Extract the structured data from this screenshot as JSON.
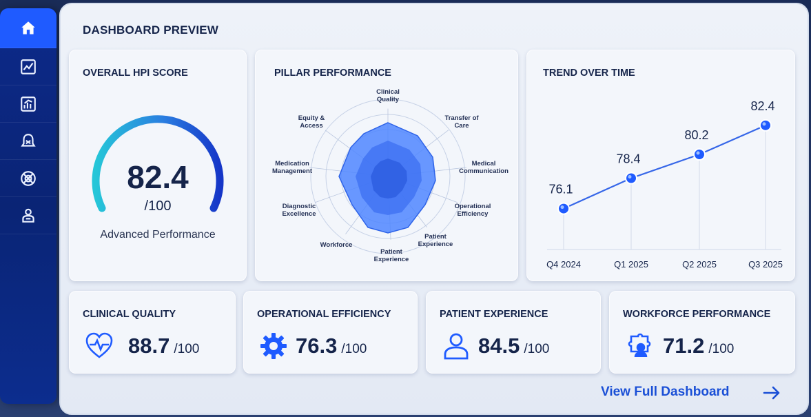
{
  "sidebar": {
    "items": [
      {
        "icon": "home-icon",
        "active": true
      },
      {
        "icon": "line-chart-icon"
      },
      {
        "icon": "bar-chart-icon"
      },
      {
        "icon": "alert-bell-icon"
      },
      {
        "icon": "target-icon"
      },
      {
        "icon": "team-icon"
      }
    ]
  },
  "header": {
    "title": "DASHBOARD PREVIEW"
  },
  "overall": {
    "title": "OVERALL HPI SCORE",
    "score": "82.4",
    "max": "/100",
    "label": "Advanced Performance",
    "fraction": 0.824
  },
  "pillar": {
    "title": "PILLAR PERFORMANCE",
    "axes": [
      "Clinical Quality",
      "Transfer of Care",
      "Medical Communication",
      "Operational Efficiency",
      "Patient Experience",
      "Patient Experience",
      "Workforce",
      "Diagnostic Excellence",
      "Medication Management",
      "Equity & Access"
    ]
  },
  "trend": {
    "title": "TREND OVER TIME"
  },
  "chart_data": {
    "type": "line",
    "categories": [
      "Q4 2024",
      "Q1 2025",
      "Q2 2025",
      "Q3 2025"
    ],
    "values": [
      76.1,
      78.4,
      80.2,
      82.4
    ],
    "labels": [
      "76.1",
      "78.4",
      "80.2",
      "82.4"
    ]
  },
  "tiles": [
    {
      "title": "CLINICAL QUALITY",
      "value": "88.7",
      "max": "/100",
      "icon": "heartbeat-icon"
    },
    {
      "title": "OPERATIONAL EFFICIENCY",
      "value": "76.3",
      "max": "/100",
      "icon": "gear-icon"
    },
    {
      "title": "PATIENT EXPERIENCE",
      "value": "84.5",
      "max": "/100",
      "icon": "person-icon"
    },
    {
      "title": "WORKFORCE PERFORMANCE",
      "value": "71.2",
      "max": "/100",
      "icon": "team-puzzle-icon"
    }
  ],
  "footer": {
    "link": "View Full Dashboard"
  },
  "colors": {
    "accent": "#1f5bff",
    "navy": "#15244a",
    "gauge_start": "#25c6d8",
    "gauge_end": "#1536c8"
  }
}
